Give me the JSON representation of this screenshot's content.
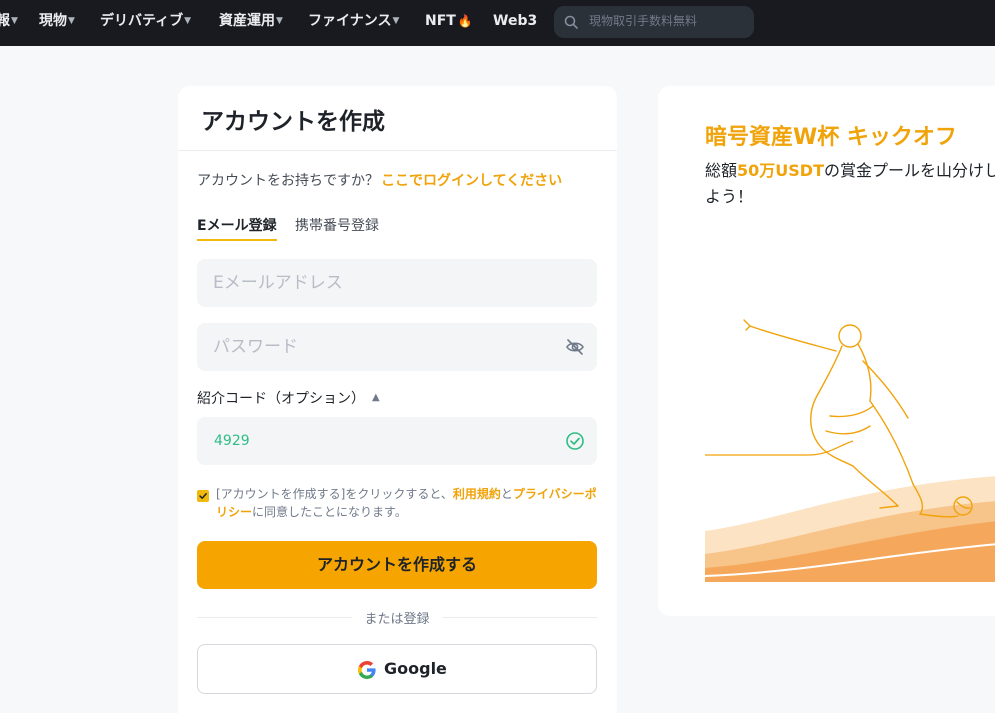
{
  "nav": {
    "items": [
      {
        "label": "報",
        "has_caret": true
      },
      {
        "label": "現物",
        "has_caret": true
      },
      {
        "label": "デリバティブ",
        "has_caret": true
      },
      {
        "label": "資産運用",
        "has_caret": true
      },
      {
        "label": "ファイナンス",
        "has_caret": true
      },
      {
        "label": "NFT",
        "has_caret": false
      },
      {
        "label": "Web3",
        "has_caret": false
      }
    ],
    "search_placeholder": "現物取引手数料無料"
  },
  "form": {
    "title": "アカウントを作成",
    "login_prompt": "アカウントをお持ちですか？",
    "login_link": "ここでログインしてください",
    "tabs": {
      "email": "Eメール登録",
      "phone": "携帯番号登録",
      "active": "email"
    },
    "email_placeholder": "Eメールアドレス",
    "password_placeholder": "パスワード",
    "referral_label": "紹介コード（オプション）",
    "referral_value": "4929",
    "agree": {
      "checked": true,
      "prefix": "[アカウントを作成する]をクリックすると、",
      "terms": "利用規約",
      "and": "と",
      "privacy": "プライバシーポリシー",
      "suffix": "に同意したことになります。"
    },
    "create_button": "アカウントを作成する",
    "or_text": "または登録",
    "google_button": "Google"
  },
  "promo": {
    "title": "暗号資産W杯 キックオフ",
    "sub_prefix": "総額",
    "sub_highlight": "50万USDT",
    "sub_suffix": "の賞金プールを山分けしよう！"
  },
  "colors": {
    "accent": "#f0a30a",
    "button": "#f6a500",
    "nav_bg": "#181a20",
    "success": "#2ebd85"
  }
}
